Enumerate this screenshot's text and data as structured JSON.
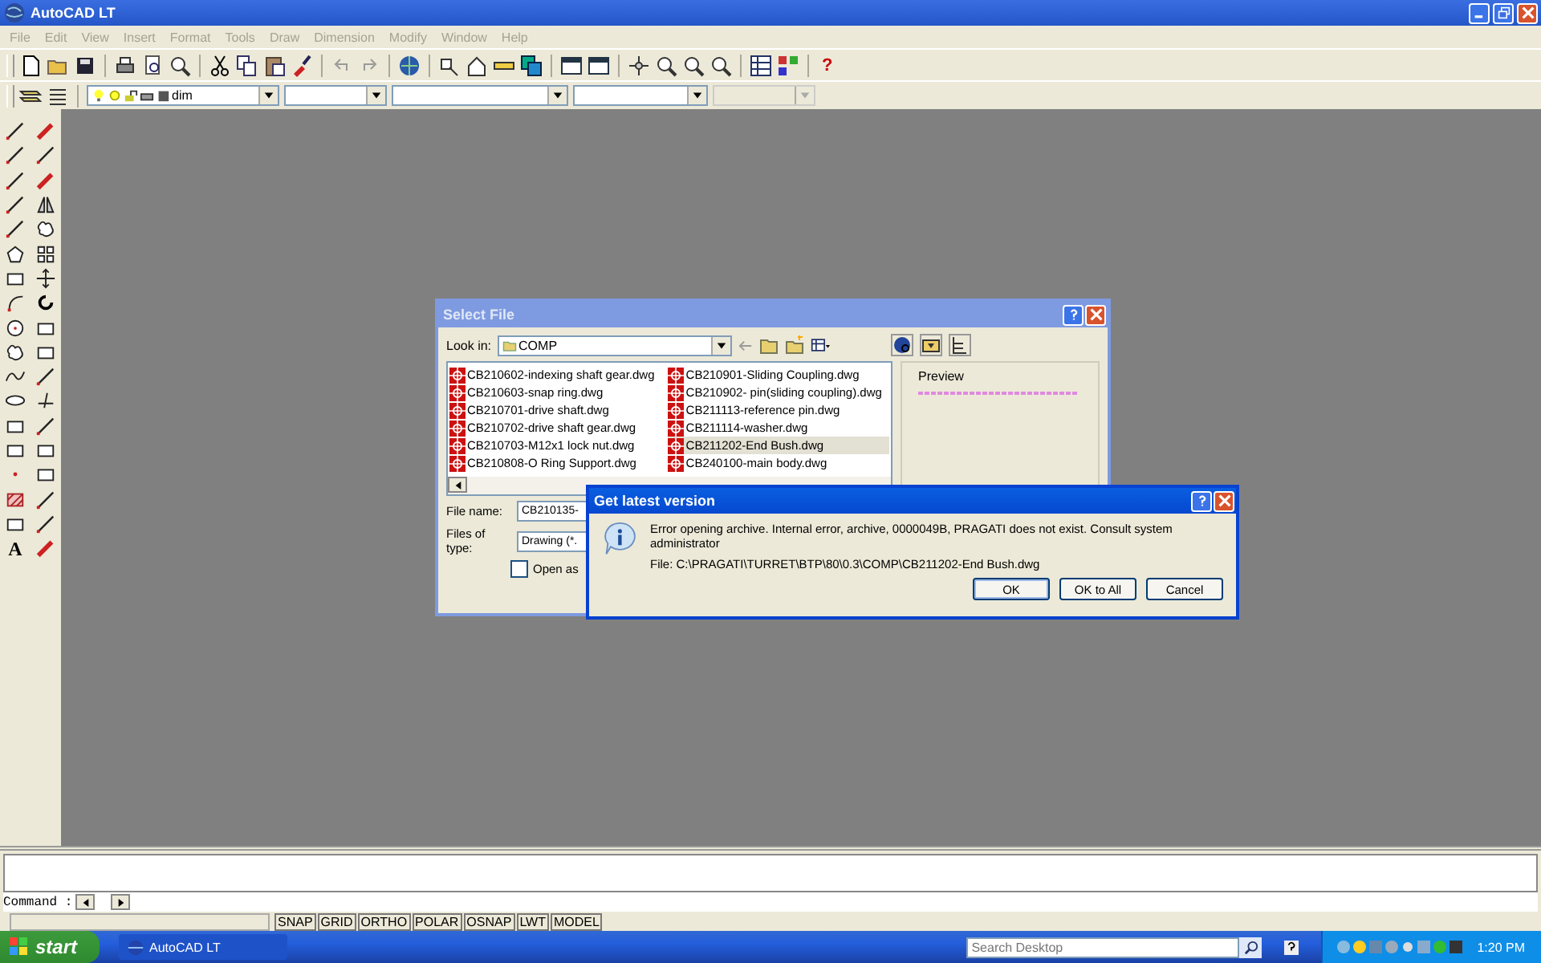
{
  "window": {
    "title": "AutoCAD LT"
  },
  "menu": [
    {
      "label": "File",
      "disabled": true
    },
    {
      "label": "Edit",
      "disabled": true
    },
    {
      "label": "View",
      "disabled": true
    },
    {
      "label": "Insert",
      "disabled": true
    },
    {
      "label": "Format",
      "disabled": true
    },
    {
      "label": "Tools",
      "disabled": true
    },
    {
      "label": "Draw",
      "disabled": true
    },
    {
      "label": "Dimension",
      "disabled": true
    },
    {
      "label": "Modify",
      "disabled": true
    },
    {
      "label": "Window",
      "disabled": true
    },
    {
      "label": "Help",
      "disabled": true
    }
  ],
  "toolbar": {
    "help_label": "?"
  },
  "layers_toolbar": {
    "layer": "dim"
  },
  "palette": {
    "text_tool_label": "A"
  },
  "select_file": {
    "title": "Select File",
    "look_in_label": "Look in:",
    "look_in_value": "COMP",
    "files": [
      {
        "name": "CB210602-indexing shaft gear.dwg",
        "selected": false
      },
      {
        "name": "CB210603-snap ring.dwg",
        "selected": false
      },
      {
        "name": "CB210701-drive shaft.dwg",
        "selected": false
      },
      {
        "name": "CB210702-drive shaft gear.dwg",
        "selected": false
      },
      {
        "name": "CB210703-M12x1 lock nut.dwg",
        "selected": false
      },
      {
        "name": "CB210808-O Ring Support.dwg",
        "selected": false
      },
      {
        "name": "CB210901-Sliding Coupling.dwg",
        "selected": false
      },
      {
        "name": "CB210902- pin(sliding coupling).dwg",
        "selected": false
      },
      {
        "name": "CB211113-reference pin.dwg",
        "selected": false
      },
      {
        "name": "CB211114-washer.dwg",
        "selected": false
      },
      {
        "name": "CB211202-End Bush.dwg",
        "selected": true
      },
      {
        "name": "CB240100-main body.dwg",
        "selected": false
      }
    ],
    "preview_label": "Preview",
    "file_name_label": "File name:",
    "file_name_value": "CB210135-",
    "files_of_type_label": "Files of type:",
    "files_of_type_value": "Drawing (*.",
    "open_as": {
      "label": "Open as",
      "checked": false
    }
  },
  "message": {
    "title": "Get latest version",
    "text": "Error opening archive. Internal error, archive, 0000049B, PRAGATI does not exist. Consult system administrator",
    "file": "File: C:\\PRAGATI\\TURRET\\BTP\\80\\0.3\\COMP\\CB211202-End Bush.dwg",
    "buttons": [
      "OK",
      "OK to All",
      "Cancel"
    ]
  },
  "command": {
    "prompt": "Command :"
  },
  "status_toggles": [
    "SNAP",
    "GRID",
    "ORTHO",
    "POLAR",
    "OSNAP",
    "LWT",
    "MODEL"
  ],
  "taskbar": {
    "start": "start",
    "task": "AutoCAD LT",
    "search_placeholder": "Search Desktop",
    "clock": "1:20 PM"
  }
}
